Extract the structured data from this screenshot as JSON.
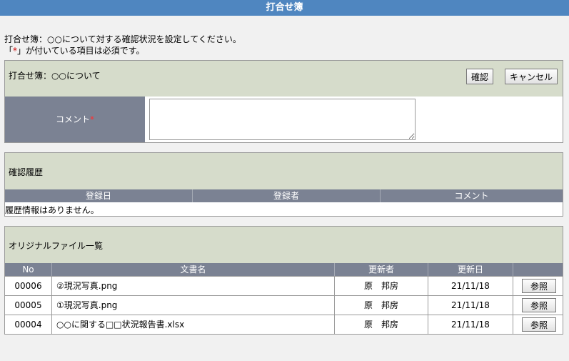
{
  "window": {
    "title": "打合せ簿"
  },
  "intro": {
    "line1": "打合せ簿：○○について対する確認状況を設定してください。",
    "line2_prefix": "「",
    "line2_mark": "*",
    "line2_suffix": "」が付いている項目は必須です。"
  },
  "confirm_panel": {
    "title": "打合せ簿：○○について",
    "confirm_label": "確認",
    "cancel_label": "キャンセル",
    "comment_label": "コメント",
    "required_mark": "*",
    "comment_value": ""
  },
  "history": {
    "title": "確認履歴",
    "columns": [
      "登録日",
      "登録者",
      "コメント"
    ],
    "empty_message": "履歴情報はありません。"
  },
  "files": {
    "title": "オリジナルファイル一覧",
    "columns": [
      "No",
      "文書名",
      "更新者",
      "更新日",
      ""
    ],
    "rows": [
      {
        "no": "00006",
        "name": "②現況写真.png",
        "updater": "原　邦房",
        "date": "21/11/18",
        "action": "参照"
      },
      {
        "no": "00005",
        "name": "①現況写真.png",
        "updater": "原　邦房",
        "date": "21/11/18",
        "action": "参照"
      },
      {
        "no": "00004",
        "name": "○○に関する□□状況報告書.xlsx",
        "updater": "原　邦房",
        "date": "21/11/18",
        "action": "参照"
      }
    ]
  }
}
